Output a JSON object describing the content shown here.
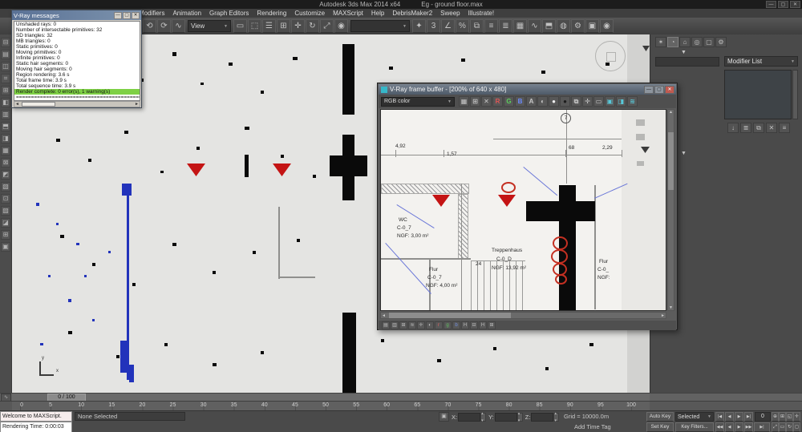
{
  "window": {
    "app_title": "Autodesk 3ds Max 2014 x64",
    "document_title": "Eg - ground floor.max",
    "minimize": "—",
    "maximize": "▢",
    "close": "✕"
  },
  "menubar": {
    "items": [
      "Modifiers",
      "Animation",
      "Graph Editors",
      "Rendering",
      "Customize",
      "MAXScript",
      "Help",
      "DebrisMaker2",
      "Sweep",
      "Illustrate!"
    ]
  },
  "toolbar": {
    "group1": [
      {
        "g": "⟲",
        "n": "undo-icon"
      },
      {
        "g": "⟳",
        "n": "redo-icon"
      },
      {
        "g": "∿",
        "n": "select-link-icon"
      }
    ],
    "view_dropdown": "View",
    "group2": [
      {
        "g": "▭",
        "n": "rectangular-selection-icon"
      },
      {
        "g": "⬚",
        "n": "select-object-icon"
      },
      {
        "g": "☰",
        "n": "select-by-name-icon"
      },
      {
        "g": "⊞",
        "n": "window-crossing-icon"
      },
      {
        "g": "✛",
        "n": "select-move-icon"
      },
      {
        "g": "↻",
        "n": "select-rotate-icon"
      },
      {
        "g": "⤢",
        "n": "select-scale-icon"
      },
      {
        "g": "◉",
        "n": "use-pivot-center-icon"
      }
    ],
    "selection_set_dropdown": "",
    "group3": [
      {
        "g": "✦",
        "n": "select-manipulate-icon"
      },
      {
        "g": "3",
        "n": "snap-toggle-icon"
      },
      {
        "g": "∠",
        "n": "angle-snap-icon"
      },
      {
        "g": "%",
        "n": "percent-snap-icon"
      },
      {
        "g": "⧉",
        "n": "mirror-icon"
      },
      {
        "g": "≡",
        "n": "align-icon"
      },
      {
        "g": "≣",
        "n": "layer-manager-icon"
      },
      {
        "g": "▦",
        "n": "graphite-toggle-icon"
      },
      {
        "g": "∿",
        "n": "curve-editor-icon"
      },
      {
        "g": "⬒",
        "n": "schematic-view-icon"
      },
      {
        "g": "◍",
        "n": "material-editor-icon"
      },
      {
        "g": "⚙",
        "n": "render-setup-icon"
      },
      {
        "g": "▣",
        "n": "rendered-frame-icon"
      },
      {
        "g": "◉",
        "n": "render-production-icon"
      }
    ]
  },
  "left_toolbar": {
    "icons": [
      {
        "g": "⊟",
        "n": "left-toolbar-icon"
      },
      {
        "g": "▤",
        "n": "left-toolbar-icon"
      },
      {
        "g": "◫",
        "n": "left-toolbar-icon"
      },
      {
        "g": "⌗",
        "n": "left-toolbar-icon"
      },
      {
        "g": "⊞",
        "n": "left-toolbar-icon"
      },
      {
        "g": "◧",
        "n": "left-toolbar-icon"
      },
      {
        "g": "▥",
        "n": "left-toolbar-icon"
      },
      {
        "g": "⬒",
        "n": "left-toolbar-icon"
      },
      {
        "g": "◨",
        "n": "left-toolbar-icon"
      },
      {
        "g": "▦",
        "n": "left-toolbar-icon"
      },
      {
        "g": "⊠",
        "n": "left-toolbar-icon"
      },
      {
        "g": "◩",
        "n": "left-toolbar-icon"
      },
      {
        "g": "▧",
        "n": "left-toolbar-icon"
      },
      {
        "g": "⊡",
        "n": "left-toolbar-icon"
      },
      {
        "g": "▨",
        "n": "left-toolbar-icon"
      },
      {
        "g": "◪",
        "n": "left-toolbar-icon"
      },
      {
        "g": "⊞",
        "n": "left-toolbar-icon"
      },
      {
        "g": "▣",
        "n": "left-toolbar-icon"
      }
    ]
  },
  "vray_messages": {
    "title": "V-Ray messages",
    "buttons": [
      "—",
      "▢",
      "✕"
    ],
    "lines": [
      {
        "t": "Unshaded rays: 0"
      },
      {
        "t": "Number of intersectable primitives: 32"
      },
      {
        "t": "SD triangles: 32"
      },
      {
        "t": "MB triangles: 0"
      },
      {
        "t": "Static primitives: 0"
      },
      {
        "t": "Moving primitives: 0"
      },
      {
        "t": "Infinite primitives: 0"
      },
      {
        "t": "Static hair segments: 0"
      },
      {
        "t": "Moving hair segments: 0"
      },
      {
        "t": "Region rendering: 3.6 s"
      },
      {
        "t": "Total frame time: 3.9 s"
      },
      {
        "t": "Total sequence time: 3.9 s"
      },
      {
        "t": "Render complete: 0 error(s), 1 warning(s)",
        "hl": true
      },
      {
        "t": "================================================"
      }
    ]
  },
  "framebuffer": {
    "title": "V-Ray frame buffer - [200% of 640 x 480]",
    "buttons": [
      "—",
      "▢",
      "✕"
    ],
    "channel_dropdown": "RGB color",
    "toolbar_icons": [
      {
        "g": "▦",
        "n": "save-image-icon"
      },
      {
        "g": "⊞",
        "n": "load-image-icon"
      },
      {
        "g": "✕",
        "n": "clear-image-icon"
      },
      {
        "g": "R",
        "n": "red-channel-icon",
        "c": "#e05555"
      },
      {
        "g": "G",
        "n": "green-channel-icon",
        "c": "#5ad05a"
      },
      {
        "g": "B",
        "n": "blue-channel-icon",
        "c": "#6a8aff"
      },
      {
        "g": "A",
        "n": "alpha-channel-icon"
      },
      {
        "g": "◐",
        "n": "monochrome-icon"
      },
      {
        "g": "●",
        "n": "white-level-icon",
        "c": "#f0f0f0"
      },
      {
        "g": "●",
        "n": "black-level-icon",
        "c": "#1c1c1c"
      },
      {
        "g": "⧉",
        "n": "duplicate-buffer-icon"
      },
      {
        "g": "✛",
        "n": "track-mouse-icon"
      },
      {
        "g": "▭",
        "n": "region-render-icon"
      },
      {
        "g": "▣",
        "n": "color-correction-icon",
        "c": "#58c8d8"
      },
      {
        "g": "◨",
        "n": "srgb-icon",
        "c": "#58c8d8"
      },
      {
        "g": "≋",
        "n": "curves-icon",
        "c": "#58c8d8"
      }
    ],
    "bottom_icons": [
      {
        "g": "▤",
        "n": "fb-info-icon"
      },
      {
        "g": "▥",
        "n": "fb-histogram-icon"
      },
      {
        "g": "⊞",
        "n": "fb-pixel-info-icon"
      },
      {
        "g": "≋",
        "n": "fb-curves-icon"
      },
      {
        "g": "✛",
        "n": "fb-crosshair-icon"
      },
      {
        "g": "◐",
        "n": "fb-compare-icon"
      },
      {
        "g": "r",
        "n": "fb-red-icon",
        "c": "#e06060"
      },
      {
        "g": "g",
        "n": "fb-green-icon",
        "c": "#60c060"
      },
      {
        "g": "b",
        "n": "fb-blue-icon",
        "c": "#7090e0"
      },
      {
        "g": "H",
        "n": "fb-h-icon"
      },
      {
        "g": "⊟",
        "n": "fb-collapse-icon"
      },
      {
        "g": "H",
        "n": "fb-h2-icon"
      },
      {
        "g": "⊞",
        "n": "fb-expand-icon"
      }
    ],
    "labels": {
      "wc_name": "WC",
      "wc_code": "C-0_7",
      "wc_area": "NGF: 3,00 m²",
      "flur_name": "Flur",
      "flur_code": "C-0_7",
      "flur_area": "NGF: 4,00 m²",
      "stairs_name": "Treppenhaus",
      "stairs_code": "C-0_D",
      "stairs_area": "NGF: 13,92 m²",
      "flur2_name": "Flur",
      "flur2_code": "C-0_",
      "flur2_area": "NGF:",
      "room_number": "24",
      "bubble": "7",
      "d1": "4,92",
      "d2": "1,57",
      "d3": "68",
      "d4": "2,29"
    },
    "marks": [
      [
        "h",
        0,
        92,
        110,
        13
      ],
      [
        "h",
        96,
        105,
        13,
        82
      ],
      [
        "g",
        100,
        92,
        1,
        158
      ],
      [
        "g",
        0,
        185,
        112,
        2
      ],
      [
        "g",
        60,
        187,
        2,
        63
      ],
      [
        "g",
        266,
        94,
        2,
        155
      ],
      [
        "g",
        0,
        56,
        300,
        1
      ],
      [
        "g",
        140,
        36,
        160,
        1
      ],
      [
        "g",
        231,
        0,
        1,
        92
      ],
      [
        "g",
        18,
        50,
        1,
        9
      ],
      [
        "g",
        78,
        50,
        1,
        9
      ],
      [
        "g",
        230,
        50,
        1,
        9
      ],
      [
        "g",
        300,
        50,
        1,
        9
      ],
      [
        "k",
        222,
        94,
        21,
        158
      ],
      [
        "k",
        181,
        114,
        86,
        25
      ],
      [
        "r",
        64,
        106,
        22,
        15
      ],
      [
        "r",
        146,
        106,
        22,
        15
      ],
      [
        "rc",
        150,
        90,
        18,
        14
      ],
      [
        "rc",
        214,
        158,
        19,
        17
      ],
      [
        "rc",
        212,
        174,
        21,
        18
      ],
      [
        "rc",
        214,
        191,
        18,
        16
      ],
      [
        "rc",
        217,
        205,
        15,
        13
      ],
      [
        "bl",
        6,
        166,
        85,
        48
      ],
      [
        "bl",
        178,
        71,
        55,
        40
      ],
      [
        "bl",
        266,
        110,
        45,
        -24
      ],
      [
        "bl",
        20,
        118,
        55,
        32
      ],
      [
        "s",
        112,
        188,
        68,
        62
      ],
      [
        "gs",
        318,
        12,
        11,
        8
      ],
      [
        "gs",
        318,
        30,
        11,
        8
      ],
      [
        "gs",
        319,
        64,
        9,
        6
      ],
      [
        "dt",
        324,
        46,
        11,
        8
      ]
    ]
  },
  "viewport": {
    "marks": [
      [
        "k",
        412,
        12,
        15,
        88
      ],
      [
        "k",
        412,
        125,
        15,
        82
      ],
      [
        "k",
        396,
        151,
        47,
        26
      ],
      [
        "k",
        290,
        150,
        5,
        28
      ],
      [
        "k",
        412,
        347,
        17,
        100
      ],
      [
        "u",
        137,
        186,
        12,
        15
      ],
      [
        "u",
        143,
        201,
        3,
        230
      ],
      [
        "u",
        135,
        382,
        9,
        40
      ],
      [
        "u",
        146,
        412,
        6,
        22
      ],
      [
        "r",
        218,
        161,
        23,
        16
      ],
      [
        "r",
        325,
        161,
        23,
        16
      ],
      [
        "y",
        455,
        304,
        10,
        5
      ],
      [
        "g",
        332,
        215,
        2,
        90
      ],
      [
        "g",
        332,
        302,
        46,
        2
      ],
      [
        "dt",
        786,
        14,
        9,
        7
      ],
      [
        "k",
        40,
        25,
        5,
        4
      ],
      [
        "k",
        75,
        40,
        4,
        4
      ],
      [
        "k",
        120,
        30,
        6,
        3
      ],
      [
        "k",
        160,
        55,
        4,
        4
      ],
      [
        "k",
        200,
        22,
        5,
        5
      ],
      [
        "k",
        235,
        60,
        4,
        3
      ],
      [
        "k",
        270,
        35,
        5,
        4
      ],
      [
        "k",
        310,
        70,
        4,
        4
      ],
      [
        "k",
        350,
        28,
        6,
        4
      ],
      [
        "k",
        470,
        40,
        5,
        4
      ],
      [
        "k",
        520,
        65,
        4,
        4
      ],
      [
        "k",
        560,
        30,
        5,
        4
      ],
      [
        "k",
        610,
        75,
        4,
        3
      ],
      [
        "k",
        660,
        45,
        5,
        4
      ],
      [
        "k",
        705,
        90,
        4,
        4
      ],
      [
        "k",
        740,
        35,
        5,
        4
      ],
      [
        "k",
        55,
        130,
        5,
        4
      ],
      [
        "k",
        95,
        155,
        4,
        4
      ],
      [
        "k",
        140,
        120,
        5,
        4
      ],
      [
        "k",
        185,
        170,
        4,
        3
      ],
      [
        "k",
        230,
        140,
        4,
        4
      ],
      [
        "k",
        290,
        115,
        6,
        4
      ],
      [
        "k",
        335,
        150,
        4,
        4
      ],
      [
        "k",
        375,
        175,
        4,
        4
      ],
      [
        "k",
        460,
        125,
        5,
        4
      ],
      [
        "k",
        510,
        160,
        4,
        4
      ],
      [
        "k",
        575,
        135,
        5,
        4
      ],
      [
        "k",
        620,
        170,
        4,
        4
      ],
      [
        "k",
        680,
        120,
        5,
        4
      ],
      [
        "k",
        730,
        155,
        4,
        4
      ],
      [
        "k",
        60,
        250,
        5,
        4
      ],
      [
        "k",
        100,
        285,
        4,
        4
      ],
      [
        "k",
        150,
        310,
        4,
        4
      ],
      [
        "k",
        200,
        260,
        5,
        4
      ],
      [
        "k",
        250,
        295,
        4,
        4
      ],
      [
        "k",
        300,
        270,
        4,
        4
      ],
      [
        "k",
        355,
        255,
        4,
        4
      ],
      [
        "k",
        460,
        280,
        5,
        4
      ],
      [
        "k",
        520,
        310,
        4,
        4
      ],
      [
        "k",
        585,
        265,
        4,
        4
      ],
      [
        "k",
        640,
        300,
        5,
        4
      ],
      [
        "k",
        700,
        275,
        4,
        4
      ],
      [
        "k",
        70,
        370,
        5,
        4
      ],
      [
        "k",
        130,
        400,
        4,
        4
      ],
      [
        "k",
        190,
        385,
        4,
        4
      ],
      [
        "k",
        250,
        410,
        5,
        4
      ],
      [
        "k",
        310,
        395,
        4,
        4
      ],
      [
        "k",
        460,
        380,
        4,
        4
      ],
      [
        "k",
        530,
        405,
        5,
        4
      ],
      [
        "k",
        600,
        390,
        4,
        4
      ],
      [
        "k",
        665,
        415,
        4,
        4
      ],
      [
        "k",
        720,
        385,
        5,
        4
      ],
      [
        "u",
        30,
        210,
        4,
        4
      ],
      [
        "u",
        55,
        235,
        3,
        3
      ],
      [
        "u",
        80,
        260,
        4,
        3
      ],
      [
        "u",
        45,
        300,
        3,
        3
      ],
      [
        "u",
        70,
        330,
        4,
        4
      ],
      [
        "u",
        100,
        355,
        3,
        3
      ],
      [
        "u",
        35,
        385,
        4,
        3
      ],
      [
        "u",
        90,
        300,
        3,
        3
      ],
      [
        "u",
        120,
        270,
        3,
        3
      ],
      [
        "u",
        540,
        200,
        3,
        3
      ],
      [
        "u",
        600,
        225,
        4,
        3
      ],
      [
        "u",
        660,
        250,
        3,
        3
      ],
      [
        "u",
        710,
        210,
        3,
        3
      ],
      [
        "u",
        580,
        330,
        3,
        3
      ],
      [
        "u",
        630,
        360,
        4,
        3
      ]
    ]
  },
  "right_panel": {
    "tabs": [
      {
        "g": "✶",
        "n": "create-tab-icon"
      },
      {
        "g": "◔",
        "n": "modify-tab-icon",
        "active": true
      },
      {
        "g": "⌂",
        "n": "hierarchy-tab-icon"
      },
      {
        "g": "◎",
        "n": "motion-tab-icon"
      },
      {
        "g": "▢",
        "n": "display-tab-icon"
      },
      {
        "g": "⚙",
        "n": "utilities-tab-icon"
      }
    ],
    "modifier_list_label": "Modifier List",
    "chevron": "▼",
    "stack_buttons": [
      {
        "g": "↓",
        "n": "pin-stack-button"
      },
      {
        "g": "≣",
        "n": "show-end-result-button"
      },
      {
        "g": "⧉",
        "n": "make-unique-button"
      },
      {
        "g": "✕",
        "n": "remove-modifier-button"
      },
      {
        "g": "≡",
        "n": "configure-modifier-sets-button"
      }
    ]
  },
  "timeline": {
    "slider_label": "0 / 100",
    "mini_button": "∿",
    "ticks": [
      0,
      5,
      10,
      15,
      20,
      25,
      30,
      35,
      40,
      45,
      50,
      55,
      60,
      65,
      70,
      75,
      80,
      85,
      90,
      95,
      100
    ]
  },
  "statusbar": {
    "listener_line1": "Welcome to MAXScript.",
    "listener_line2": "Rendering Time: 0:00:03",
    "selection_status": "None Selected",
    "lock_icon": "▣",
    "coords": [
      {
        "label": "X:",
        "value": ""
      },
      {
        "label": "Y:",
        "value": ""
      },
      {
        "label": "Z:",
        "value": ""
      }
    ],
    "grid_label": "Grid = 10000.0m",
    "time_tag_label": "Add Time Tag"
  },
  "anim": {
    "auto_key": "Auto Key",
    "set_key": "Set Key",
    "selected": "Selected",
    "key_filters": "Key Filters...",
    "frame_value": "0",
    "playback_row1": [
      {
        "g": "|◀",
        "n": "go-to-start-button"
      },
      {
        "g": "◀",
        "n": "previous-frame-button"
      },
      {
        "g": "▶",
        "n": "play-button"
      },
      {
        "g": "▶|",
        "n": "go-to-end-button"
      }
    ],
    "playback_row2": [
      {
        "g": "◀◀",
        "n": "previous-key-button"
      },
      {
        "g": "◀",
        "n": "sub-previous-button"
      },
      {
        "g": "▶",
        "n": "sub-next-button"
      },
      {
        "g": "▶▶",
        "n": "next-key-button"
      },
      {
        "g": "▶|",
        "n": "end-frame-button",
        "w": 20
      }
    ],
    "nav_row1": [
      {
        "g": "⊕",
        "n": "zoom-button"
      },
      {
        "g": "⊞",
        "n": "zoom-all-button"
      },
      {
        "g": "◱",
        "n": "zoom-extents-button"
      },
      {
        "g": "✛",
        "n": "pan-button"
      }
    ],
    "nav_row2": [
      {
        "g": "⤢",
        "n": "fov-button"
      },
      {
        "g": "▭",
        "n": "zoom-region-button"
      },
      {
        "g": "↻",
        "n": "orbit-button"
      },
      {
        "g": "◻",
        "n": "maximize-viewport-button"
      }
    ]
  }
}
